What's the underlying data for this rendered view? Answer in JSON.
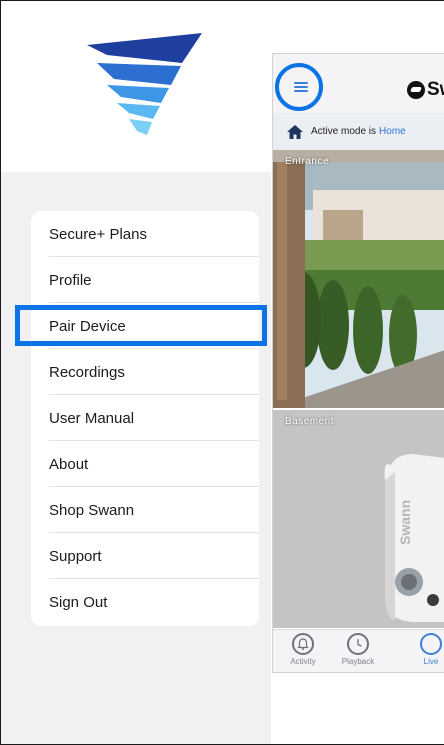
{
  "menu": {
    "items": [
      {
        "label": "Secure+ Plans"
      },
      {
        "label": "Profile"
      },
      {
        "label": "Pair Device"
      },
      {
        "label": "Recordings"
      },
      {
        "label": "User Manual"
      },
      {
        "label": "About"
      },
      {
        "label": "Shop Swann"
      },
      {
        "label": "Support"
      },
      {
        "label": "Sign Out"
      }
    ],
    "highlighted_item": "Pair Device"
  },
  "app": {
    "brand": "Sw",
    "mode_prefix": "Active mode is",
    "mode_value": "Home",
    "cameras": [
      {
        "label": "Entrance"
      },
      {
        "label": "Basement"
      }
    ],
    "tabs": [
      {
        "label": "Activity",
        "icon": "bell-icon"
      },
      {
        "label": "Playback",
        "icon": "clock-icon"
      },
      {
        "label": "Live",
        "icon": "live-icon"
      }
    ]
  },
  "colors": {
    "accent": "#0a73e6",
    "link": "#2f74d0",
    "logo_blues": [
      "#1f3f9e",
      "#2c6fd0",
      "#3d97e6",
      "#5bb8f0",
      "#7dd0f5"
    ]
  }
}
